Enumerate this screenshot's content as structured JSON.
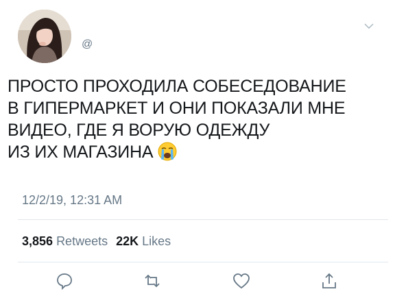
{
  "tweet": {
    "handle": "@",
    "lines": [
      "ПРОСТО ПРОХОДИЛА СОБЕСЕДОВАНИЕ",
      "В ГИПЕРМАРКЕТ И ОНИ ПОКАЗАЛИ МНЕ",
      "ВИДЕО, ГДЕ Я ВОРУЮ ОДЕЖДУ",
      "ИЗ ИХ МАГАЗИНА"
    ],
    "emoji": "loudly-crying-face",
    "timestamp": "12/2/19, 12:31 AM"
  },
  "stats": {
    "retweets_count": "3,856",
    "retweets_label": "Retweets",
    "likes_count": "22K",
    "likes_label": "Likes"
  },
  "icons": {
    "caret": "chevron-down-icon",
    "reply": "reply-icon",
    "retweet": "retweet-icon",
    "like": "heart-icon",
    "share": "share-icon"
  },
  "colors": {
    "text": "#14171a",
    "secondary": "#657786",
    "divider": "#e1e8ed"
  }
}
